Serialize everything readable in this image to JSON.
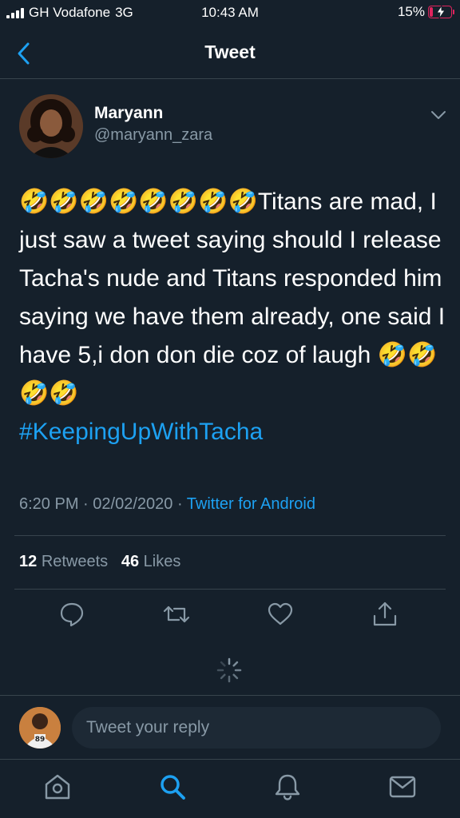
{
  "status_bar": {
    "carrier": "GH Vodafone",
    "network": "3G",
    "time": "10:43 AM",
    "battery_percent": "15%",
    "battery_level": 0.15,
    "battery_color": "#e0245e"
  },
  "nav": {
    "title": "Tweet",
    "back_icon": "chevron-left-icon"
  },
  "tweet": {
    "author_name": "Maryann",
    "author_handle": "@maryann_zara",
    "text_lead_emoji": "🤣🤣🤣🤣🤣🤣🤣🤣",
    "text_body": "Titans are mad, I just saw a tweet saying should I release Tacha's nude and Titans responded him saying we have them already, one said I have 5,i don don die coz of laugh",
    "text_trail_emoji": "🤣🤣🤣🤣",
    "hashtag": "#KeepingUpWithTacha",
    "time": "6:20 PM",
    "date": "02/02/2020",
    "source": "Twitter for Android",
    "retweets_count": "12",
    "retweets_label": "Retweets",
    "likes_count": "46",
    "likes_label": "Likes"
  },
  "actions": [
    "reply-icon",
    "retweet-icon",
    "like-icon",
    "share-icon"
  ],
  "reply": {
    "placeholder": "Tweet your reply"
  },
  "tab_bar": [
    "home-icon",
    "search-icon",
    "notifications-icon",
    "messages-icon"
  ],
  "colors": {
    "background": "#15202b",
    "accent": "#1da1f2",
    "secondary_text": "#8899a6",
    "divider": "#38444d"
  }
}
